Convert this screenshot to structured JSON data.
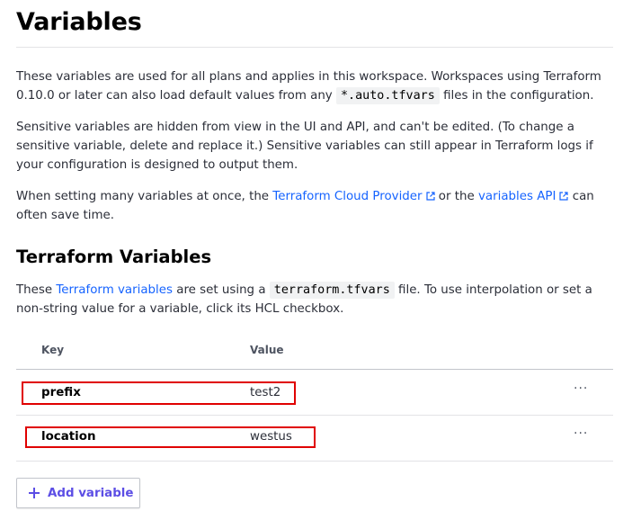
{
  "page": {
    "title": "Variables"
  },
  "intro": {
    "p1_before": "These variables are used for all plans and applies in this workspace. Workspaces using Terraform 0.10.0 or later can also load default values from any ",
    "p1_code": "*.auto.tfvars",
    "p1_after": " files in the configuration.",
    "p2": "Sensitive variables are hidden from view in the UI and API, and can't be edited. (To change a sensitive variable, delete and replace it.) Sensitive variables can still appear in Terraform logs if your configuration is designed to output them.",
    "p3_before": "When setting many variables at once, the ",
    "p3_link1": "Terraform Cloud Provider",
    "p3_middle": " or the ",
    "p3_link2": "variables API",
    "p3_after": " can often save time."
  },
  "terraform_vars": {
    "title": "Terraform Variables",
    "desc_before": "These ",
    "desc_link": "Terraform variables",
    "desc_middle": " are set using a ",
    "desc_code": "terraform.tfvars",
    "desc_after": " file. To use interpolation or set a non-string value for a variable, click its HCL checkbox.",
    "columns": {
      "key": "Key",
      "value": "Value"
    },
    "rows": [
      {
        "key": "prefix",
        "value": "test2",
        "more": "···"
      },
      {
        "key": "location",
        "value": "westus",
        "more": "···"
      }
    ],
    "add_button": "Add variable"
  },
  "colors": {
    "link": "#1563ff",
    "button_accent": "#5c4ee5",
    "highlight": "#e00000"
  },
  "icons": {
    "external": "external-link-icon",
    "add": "plus-icon",
    "menu": "ellipsis-icon"
  }
}
